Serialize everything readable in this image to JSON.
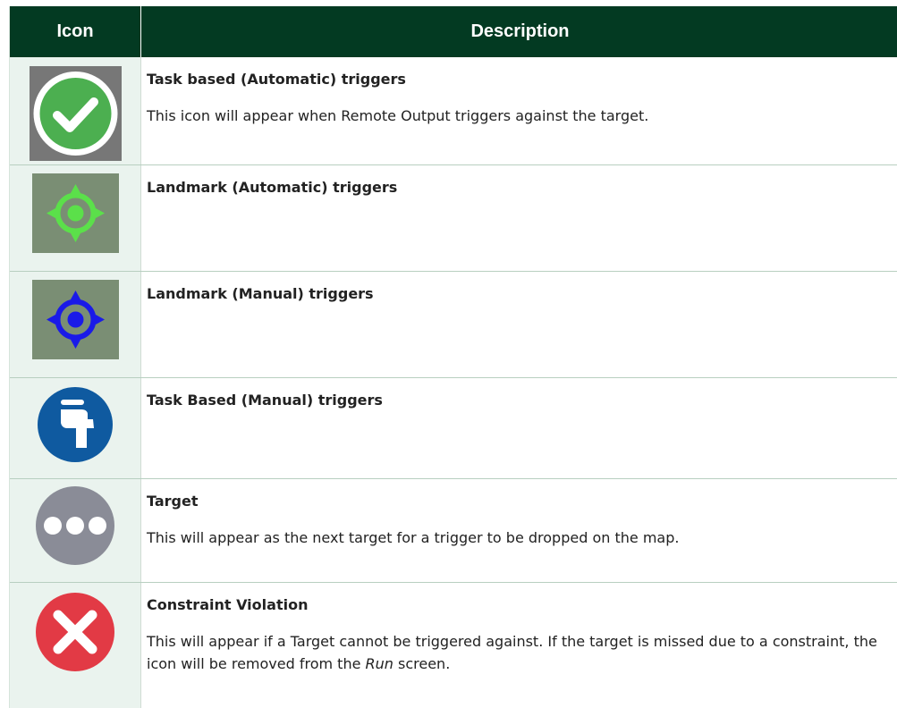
{
  "header": {
    "col_icon": "Icon",
    "col_description": "Description"
  },
  "rows": [
    {
      "icon": "check-circle-icon",
      "title": "Task based (Automatic) triggers",
      "body": "This icon will appear when Remote Output triggers against the target."
    },
    {
      "icon": "green-crosshair-icon",
      "title": "Landmark (Automatic) triggers",
      "body": ""
    },
    {
      "icon": "blue-crosshair-icon",
      "title": "Landmark (Manual) triggers",
      "body": ""
    },
    {
      "icon": "hand-pointer-icon",
      "title": "Task Based (Manual) triggers",
      "body": ""
    },
    {
      "icon": "ellipsis-icon",
      "title": "Target",
      "body": "This will appear as the next target for a trigger to be dropped on the map."
    },
    {
      "icon": "x-circle-icon",
      "title": "Constraint Violation",
      "body_before": "This will appear if a Target cannot be triggered against. If the target is missed due to a constraint, the icon will be removed from the ",
      "body_em": "Run",
      "body_after": " screen."
    }
  ],
  "colors": {
    "header_bg": "#033a22",
    "icon_cell_bg": "#eaf3ee",
    "check_green": "#4caf50",
    "crosshair_green": "#5be04a",
    "crosshair_blue": "#1a1ae8",
    "hand_blue": "#0f5aa0",
    "target_gray": "#8a8c97",
    "x_red": "#e23a45"
  }
}
